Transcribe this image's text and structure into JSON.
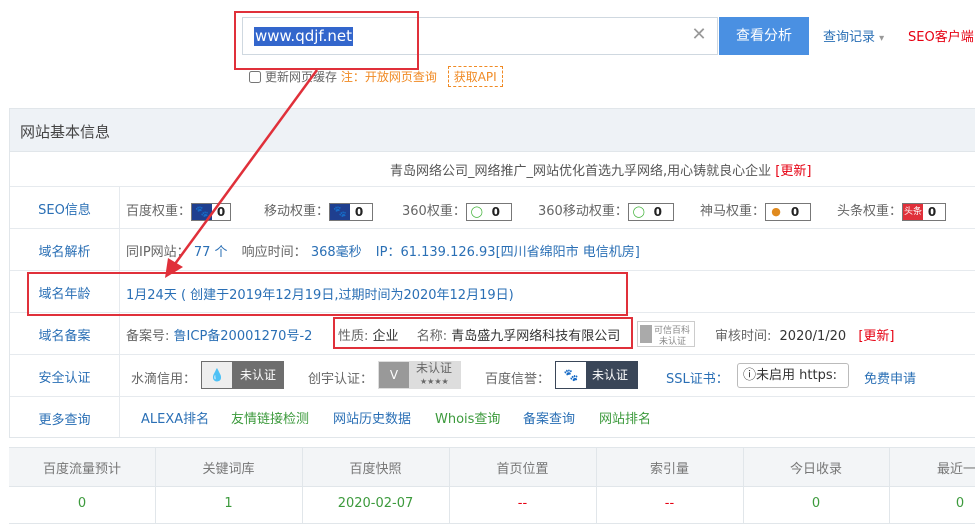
{
  "search": {
    "query": "www.qdjf.net",
    "button_label": "查看分析"
  },
  "header": {
    "history_label": "查询记录",
    "seo_client_label": "SEO客户端"
  },
  "cache": {
    "label": "更新网页缓存",
    "note": "注：开放网页查询",
    "api_label": "获取API"
  },
  "panel": {
    "title": "网站基本信息",
    "site_title": "青岛网络公司_网络推广_网站优化首选九孚网络,用心铸就良心企业",
    "update_label": "[更新]"
  },
  "seo": {
    "label": "SEO信息",
    "items": [
      {
        "label": "百度权重：",
        "value": "0",
        "icon": "paw-icon"
      },
      {
        "label": "移动权重：",
        "value": "0",
        "icon": "paw-icon"
      },
      {
        "label": "360权重：",
        "value": "0",
        "icon": "circle-360-icon"
      },
      {
        "label": "360移动权重：",
        "value": "0",
        "icon": "circle-360-icon"
      },
      {
        "label": "神马权重：",
        "value": "0",
        "icon": "shenma-icon"
      },
      {
        "label": "头条权重：",
        "value": "0",
        "icon": "toutiao-icon",
        "icon_text": "头条"
      }
    ]
  },
  "dns": {
    "label": "域名解析",
    "same_ip_label": "同IP网站：",
    "same_ip_value": "77 个",
    "response_label": "响应时间：",
    "response_value": "368毫秒",
    "ip_label": "IP：",
    "ip_value": "61.139.126.93[四川省绵阳市 电信机房]"
  },
  "age": {
    "label": "域名年龄",
    "value": "1月24天 ( 创建于2019年12月19日,过期时间为2020年12月19日)"
  },
  "icp": {
    "label": "域名备案",
    "number_label": "备案号:",
    "number_value": "鲁ICP备20001270号-2",
    "type_label": "性质:",
    "type_value": "企业",
    "name_label": "名称:",
    "name_value": "青岛盛九孚网络科技有限公司",
    "baike_line1": "可信百科",
    "baike_line2": "未认证",
    "audit_label": "审核时间:",
    "audit_value": "2020/1/20",
    "update_label": "[更新]"
  },
  "security": {
    "label": "安全认证",
    "shuidi_label": "水滴信用：",
    "shuidi_status": "未认证",
    "chuangyu_label": "创宇认证：",
    "chuangyu_status": "未认证",
    "chuangyu_stars": "★★★★",
    "baidu_label": "百度信誉：",
    "baidu_status": "未认证",
    "ssl_label": "SSL证书：",
    "ssl_value": "未启用 https:",
    "ssl_apply": "免费申请"
  },
  "more": {
    "label": "更多查询",
    "links": [
      "ALEXA排名",
      "友情链接检测",
      "网站历史数据",
      "Whois查询",
      "备案查询",
      "网站排名"
    ]
  },
  "stats": {
    "headers": [
      "百度流量预计",
      "关键词库",
      "百度快照",
      "首页位置",
      "索引量",
      "今日收录",
      "最近一"
    ],
    "values": [
      "0",
      "1",
      "2020-02-07",
      "--",
      "--",
      "0",
      "0"
    ]
  }
}
